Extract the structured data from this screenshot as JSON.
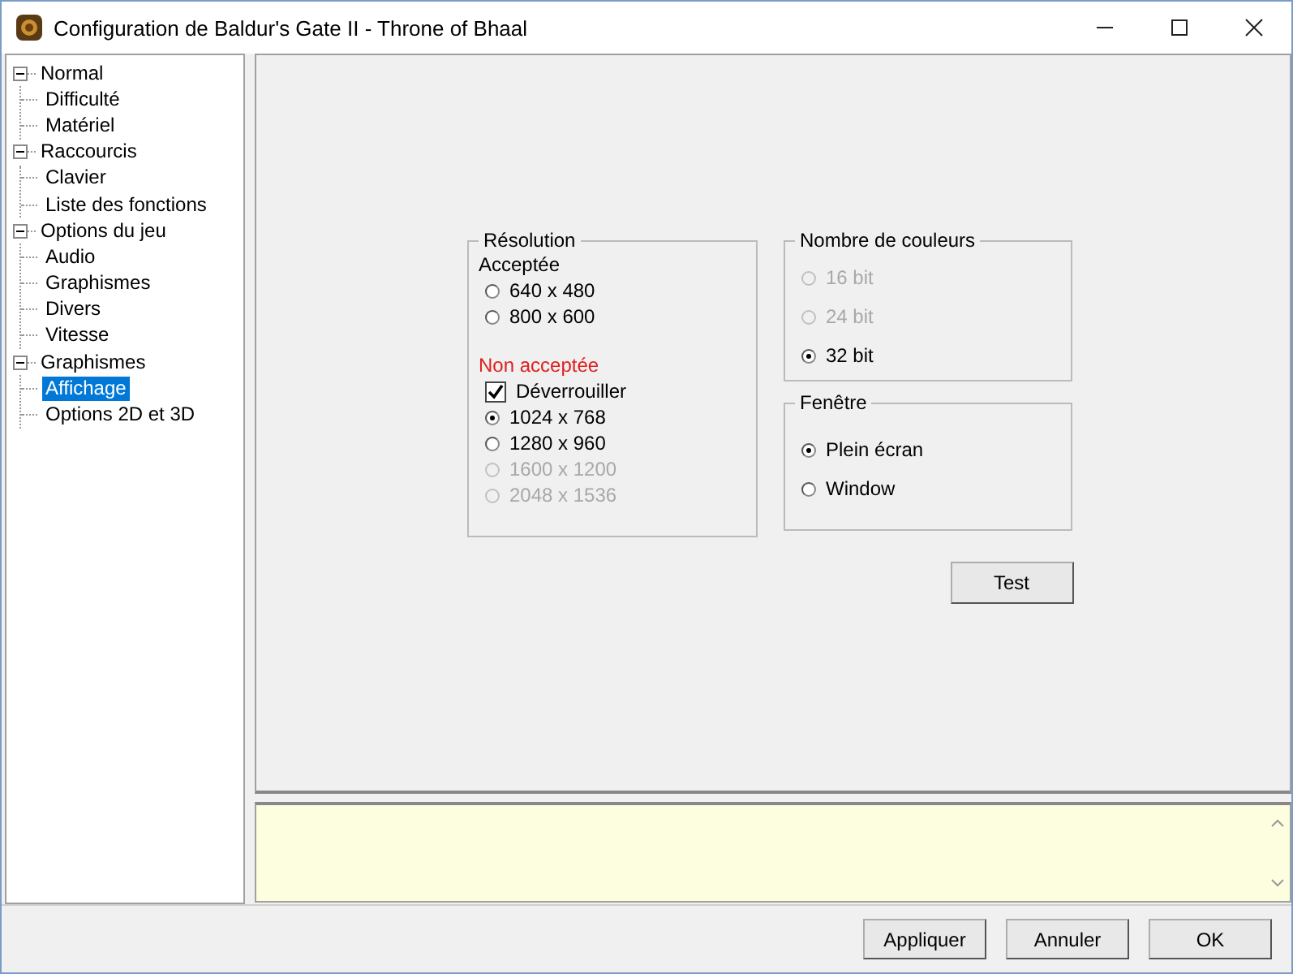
{
  "window": {
    "title": "Configuration de Baldur's Gate II - Throne of Bhaal"
  },
  "tree": [
    {
      "label": "Normal",
      "expanded": true,
      "selected": false,
      "children": [
        {
          "label": "Difficulté",
          "selected": false
        },
        {
          "label": "Matériel",
          "selected": false
        }
      ]
    },
    {
      "label": "Raccourcis",
      "expanded": true,
      "selected": false,
      "children": [
        {
          "label": "Clavier",
          "selected": false
        },
        {
          "label": "Liste des fonctions",
          "selected": false
        }
      ]
    },
    {
      "label": "Options du jeu",
      "expanded": true,
      "selected": false,
      "children": [
        {
          "label": "Audio",
          "selected": false
        },
        {
          "label": "Graphismes",
          "selected": false
        },
        {
          "label": "Divers",
          "selected": false
        },
        {
          "label": "Vitesse",
          "selected": false
        }
      ]
    },
    {
      "label": "Graphismes",
      "expanded": true,
      "selected": false,
      "children": [
        {
          "label": "Affichage",
          "selected": true
        },
        {
          "label": "Options 2D et 3D",
          "selected": false
        }
      ]
    }
  ],
  "groups": [
    {
      "title": "Résolution",
      "items": [
        {
          "kind": "heading",
          "label": "Acceptée"
        },
        {
          "kind": "radio",
          "label": "640 x 480",
          "selected": false,
          "disabled": false
        },
        {
          "kind": "radio",
          "label": "800 x 600",
          "selected": false,
          "disabled": false
        },
        {
          "kind": "warning",
          "label": "Non acceptée"
        },
        {
          "kind": "checkbox",
          "label": "Déverrouiller",
          "checked": true
        },
        {
          "kind": "radio",
          "label": "1024 x 768",
          "selected": true,
          "disabled": false
        },
        {
          "kind": "radio",
          "label": "1280 x 960",
          "selected": false,
          "disabled": false
        },
        {
          "kind": "radio",
          "label": "1600 x 1200",
          "selected": false,
          "disabled": true
        },
        {
          "kind": "radio",
          "label": "2048 x 1536",
          "selected": false,
          "disabled": true
        }
      ]
    },
    {
      "title": "Nombre de couleurs",
      "items": [
        {
          "kind": "radio",
          "label": "16 bit",
          "selected": false,
          "disabled": true
        },
        {
          "kind": "radio",
          "label": "24 bit",
          "selected": false,
          "disabled": true
        },
        {
          "kind": "radio",
          "label": "32 bit",
          "selected": true,
          "disabled": false
        }
      ]
    },
    {
      "title": "Fenêtre",
      "items": [
        {
          "kind": "radio",
          "label": "Plein écran",
          "selected": true,
          "disabled": false
        },
        {
          "kind": "radio",
          "label": "Window",
          "selected": false,
          "disabled": false
        }
      ]
    }
  ],
  "test_button": "Test",
  "buttons": [
    "Appliquer",
    "Annuler",
    "OK"
  ]
}
